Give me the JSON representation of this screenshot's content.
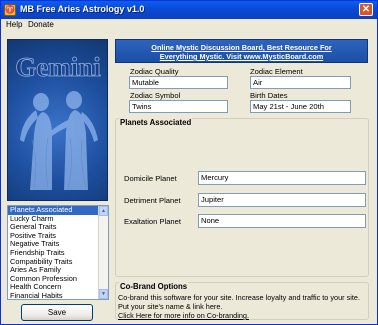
{
  "window": {
    "title": "MB Free Aries Astrology v1.0",
    "close_glyph": "✕",
    "icon_glyph": "♈"
  },
  "menu": {
    "items": [
      "Help",
      "Donate"
    ]
  },
  "left_panel": {
    "sign_name": "Gemini",
    "image": "gemini-twins-illustration"
  },
  "list": {
    "items": [
      "Planets Associated",
      "Lucky Charm",
      "General Traits",
      "Positive Traits",
      "Negative Traits",
      "Friendship Traits",
      "Compatibility Traits",
      "Aries As Family",
      "Common Profession",
      "Health Concern",
      "Financial Habits"
    ],
    "selected_index": 0
  },
  "save_button": {
    "label": "Save"
  },
  "banner": {
    "line1": "Online Mystic Discussion Board, Best Resource For",
    "line2": "Everything Mystic. Visit www.MysticBoard.com"
  },
  "info": {
    "zodiac_quality_label": "Zodiac Quality",
    "zodiac_quality_value": "Mutable",
    "zodiac_element_label": "Zodiac Element",
    "zodiac_element_value": "Air",
    "zodiac_symbol_label": "Zodiac Symbol",
    "zodiac_symbol_value": "Twins",
    "birth_dates_label": "Birth Dates",
    "birth_dates_value": "May 21st - June 20th"
  },
  "planets": {
    "legend": "Planets Associated",
    "domicile_label": "Domicile Planet",
    "domicile_value": "Mercury",
    "detriment_label": "Detriment Planet",
    "detriment_value": "Jupiter",
    "exaltation_label": "Exaltation Planet",
    "exaltation_value": "None"
  },
  "cobrand": {
    "legend": "Co-Brand Options",
    "description": "Co-brand this software for your site.  Increase loyalty and traffic to your site. Put your site's name &  link here.",
    "link": "Click Here for more info on Co-branding."
  },
  "colors": {
    "titlebar": "#0B4BD6",
    "banner": "#1C4FA6",
    "list_selected": "#316AC5",
    "panel_blue": "#1D4E9E"
  }
}
